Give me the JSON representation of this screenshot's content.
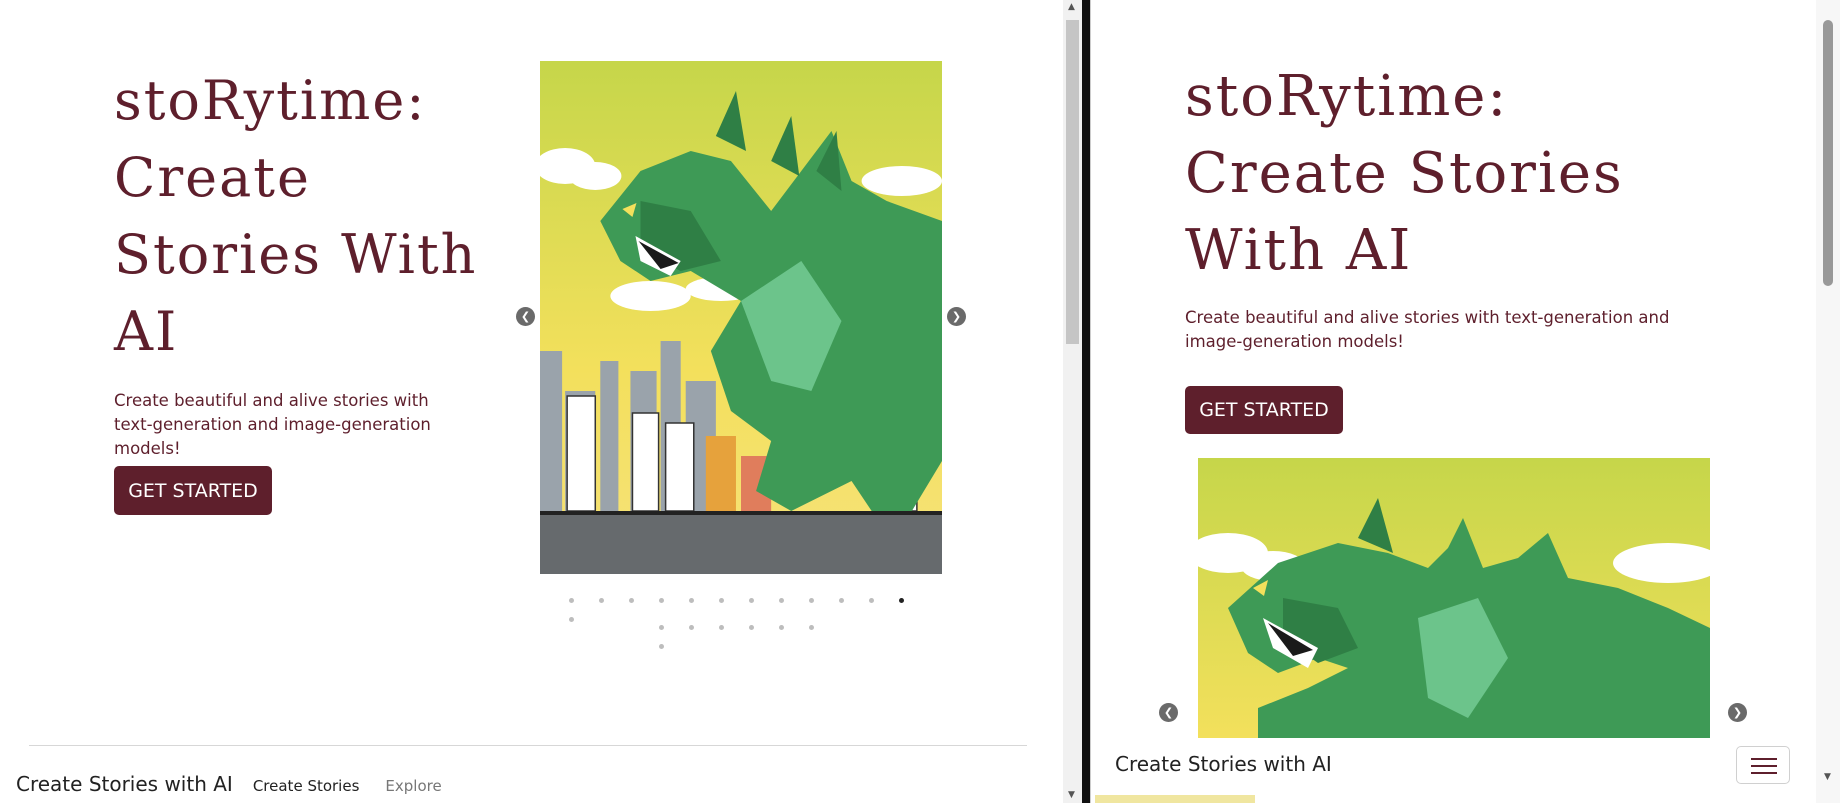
{
  "hero": {
    "title_line1": "stoRytime:",
    "title_line2": "Create Stories With AI",
    "subtitle": "Create beautiful and alive stories with text-generation and image-generation models!",
    "cta_label": "GET STARTED"
  },
  "carousel": {
    "prev_icon": "chevron-left-icon",
    "next_icon": "chevron-right-icon",
    "prev_glyph": "❮",
    "next_glyph": "❯",
    "image_subject": "origami-dinosaur-over-city",
    "slide_count": 20,
    "active_index": 11
  },
  "footer_nav": {
    "brand": "Create Stories with AI",
    "links": [
      "Create Stories",
      "Explore"
    ]
  },
  "mobile_nav": {
    "brand": "Create Stories with AI",
    "toggler_icon": "hamburger-menu-icon"
  },
  "colors": {
    "accent": "#5e1f2c",
    "background": "#ffffff",
    "sky_yellow": "#f0dc5a",
    "dino_green": "#3e9a56"
  }
}
